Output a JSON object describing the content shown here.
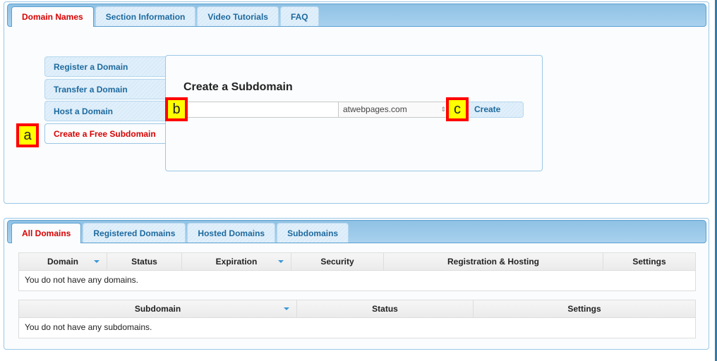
{
  "top_tabs": [
    {
      "label": "Domain Names",
      "active": true
    },
    {
      "label": "Section Information",
      "active": false
    },
    {
      "label": "Video Tutorials",
      "active": false
    },
    {
      "label": "FAQ",
      "active": false
    }
  ],
  "side_menu": [
    {
      "label": "Register a Domain",
      "active": false
    },
    {
      "label": "Transfer a Domain",
      "active": false
    },
    {
      "label": "Host a Domain",
      "active": false
    },
    {
      "label": "Create a Free Subdomain",
      "active": true
    }
  ],
  "create_subdomain": {
    "title": "Create a Subdomain",
    "input_value": "",
    "domain_select_value": "atwebpages.com",
    "create_button": "Create"
  },
  "markers": {
    "a": "a",
    "b": "b",
    "c": "c"
  },
  "bottom_tabs": [
    {
      "label": "All Domains",
      "active": true
    },
    {
      "label": "Registered Domains",
      "active": false
    },
    {
      "label": "Hosted Domains",
      "active": false
    },
    {
      "label": "Subdomains",
      "active": false
    }
  ],
  "domains_table": {
    "columns": [
      "Domain",
      "Status",
      "Expiration",
      "Security",
      "Registration & Hosting",
      "Settings"
    ],
    "empty_message": "You do not have any domains."
  },
  "subdomains_table": {
    "columns": [
      "Subdomain",
      "Status",
      "Settings"
    ],
    "empty_message": "You do not have any subdomains."
  },
  "colors": {
    "accent_active": "#d90000",
    "link_blue": "#1e6a9e",
    "tabbar_blue": "#8fc1e4",
    "marker_fill": "#ffff00",
    "marker_border": "#ff0000"
  }
}
